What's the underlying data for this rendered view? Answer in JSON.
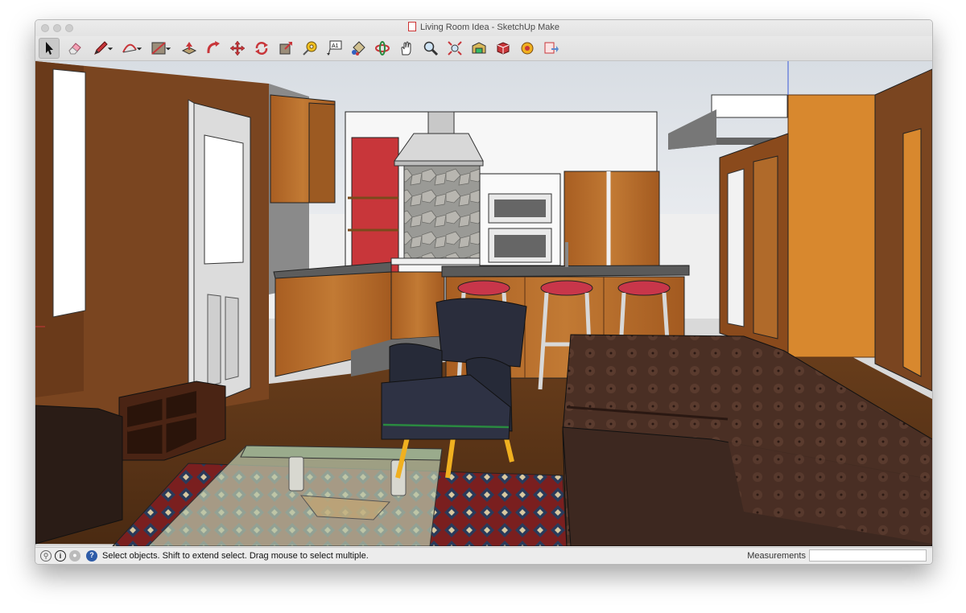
{
  "window": {
    "title": "Living Room Idea - SketchUp Make"
  },
  "toolbar": {
    "tools": [
      {
        "name": "select-tool",
        "label": "Select",
        "active": true
      },
      {
        "name": "eraser-tool",
        "label": "Eraser"
      },
      {
        "name": "pencil-tool",
        "label": "Line"
      },
      {
        "name": "arc-tool",
        "label": "Arc"
      },
      {
        "name": "rectangle-tool",
        "label": "Rectangle"
      },
      {
        "name": "push-pull-tool",
        "label": "Push/Pull"
      },
      {
        "name": "follow-me-tool",
        "label": "Follow Me"
      },
      {
        "name": "move-tool",
        "label": "Move"
      },
      {
        "name": "rotate-tool",
        "label": "Rotate"
      },
      {
        "name": "scale-tool",
        "label": "Scale"
      },
      {
        "name": "tape-measure-tool",
        "label": "Tape Measure"
      },
      {
        "name": "text-tool",
        "label": "Text",
        "glyph": "A1"
      },
      {
        "name": "paint-bucket-tool",
        "label": "Paint Bucket"
      },
      {
        "name": "orbit-tool",
        "label": "Orbit"
      },
      {
        "name": "pan-tool",
        "label": "Pan"
      },
      {
        "name": "zoom-tool",
        "label": "Zoom"
      },
      {
        "name": "zoom-extents-tool",
        "label": "Zoom Extents"
      },
      {
        "name": "3d-warehouse-tool",
        "label": "3D Warehouse"
      },
      {
        "name": "extension-warehouse-tool",
        "label": "Extension Warehouse"
      },
      {
        "name": "share-model-tool",
        "label": "Share Model"
      },
      {
        "name": "send-to-layout-tool",
        "label": "Send to LayOut"
      }
    ]
  },
  "status": {
    "message": "Select objects. Shift to extend select. Drag mouse to select multiple.",
    "measurements_label": "Measurements",
    "measurements_value": ""
  },
  "colors": {
    "accent_red": "#c8363a",
    "wood": "#b56b2c",
    "dark_wall": "#6b3a1c",
    "floor": "#5a3518",
    "sofa": "#3d2820",
    "armchair": "#2a2d3c",
    "chair_legs": "#f0b020"
  }
}
